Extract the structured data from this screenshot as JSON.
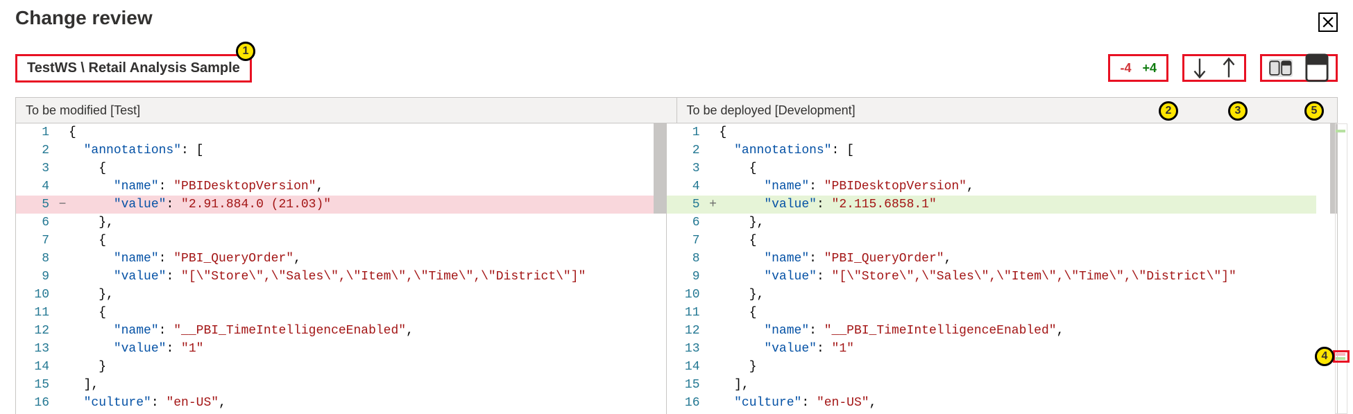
{
  "colors": {
    "accent_red": "#e81123",
    "callout_yellow": "#ffe600",
    "diff_removed": "#f9d7dc",
    "diff_added": "#e6f4d7"
  },
  "title": "Change review",
  "breadcrumb": "TestWS \\ Retail Analysis Sample",
  "counts": {
    "removed": "-4",
    "added": "+4"
  },
  "buttons": {
    "close": "close-icon",
    "prev_change": "arrow-down-icon",
    "next_change": "arrow-up-icon",
    "side_by_side": "side-by-side-view-icon",
    "inline": "inline-view-icon"
  },
  "callouts": {
    "c1": "1",
    "c2": "2",
    "c3": "3",
    "c4": "4",
    "c5": "5"
  },
  "panes": {
    "left": {
      "header": "To be modified [Test]"
    },
    "right": {
      "header": "To be deployed [Development]"
    }
  },
  "code": {
    "l1": "{",
    "l2k": "\"annotations\"",
    "l2p": ": [",
    "l3": "{",
    "l4k": "\"name\"",
    "l4c": ": ",
    "l4v": "\"PBIDesktopVersion\"",
    "l4t": ",",
    "l5k": "\"value\"",
    "l5c": ": ",
    "l5_left_v": "\"2.91.884.0 (21.03)\"",
    "l5_right_v": "\"2.115.6858.1\"",
    "l6": "},",
    "l7": "{",
    "l8k": "\"name\"",
    "l8c": ": ",
    "l8v": "\"PBI_QueryOrder\"",
    "l8t": ",",
    "l9k": "\"value\"",
    "l9c": ": ",
    "l9v": "\"[\\\"Store\\\",\\\"Sales\\\",\\\"Item\\\",\\\"Time\\\",\\\"District\\\"]\"",
    "l10": "},",
    "l11": "{",
    "l12k": "\"name\"",
    "l12c": ": ",
    "l12v": "\"__PBI_TimeIntelligenceEnabled\"",
    "l12t": ",",
    "l13k": "\"value\"",
    "l13c": ": ",
    "l13v": "\"1\"",
    "l14": "}",
    "l15": "],",
    "l16k": "\"culture\"",
    "l16c": ": ",
    "l16v": "\"en-US\"",
    "l16t": ","
  },
  "linenums": {
    "n1": "1",
    "n2": "2",
    "n3": "3",
    "n4": "4",
    "n5": "5",
    "n6": "6",
    "n7": "7",
    "n8": "8",
    "n9": "9",
    "n10": "10",
    "n11": "11",
    "n12": "12",
    "n13": "13",
    "n14": "14",
    "n15": "15",
    "n16": "16"
  },
  "markers": {
    "minus": "−",
    "plus": "+"
  }
}
